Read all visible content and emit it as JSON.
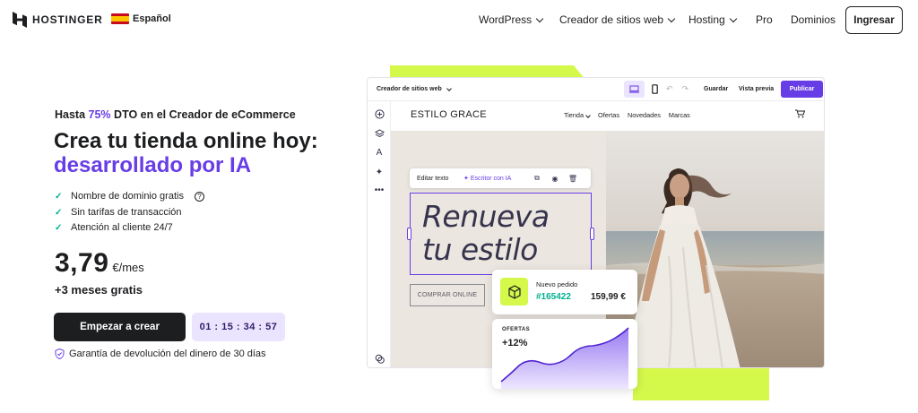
{
  "nav": {
    "brand": "HOSTINGER",
    "language": "Español",
    "menu": [
      {
        "label": "WordPress",
        "dropdown": true
      },
      {
        "label": "Creador de sitios web",
        "dropdown": true
      },
      {
        "label": "Hosting",
        "dropdown": true
      },
      {
        "label": "Pro",
        "dropdown": false
      },
      {
        "label": "Dominios",
        "dropdown": false
      }
    ],
    "login": "Ingresar"
  },
  "hero": {
    "kicker_prefix": "Hasta ",
    "kicker_highlight": "75%",
    "kicker_suffix": " DTO en el Creador de eCommerce",
    "title_line1": "Crea tu tienda online hoy:",
    "title_line2": "desarrollado por IA",
    "features": [
      "Nombre de dominio gratis",
      "Sin tarifas de transacción",
      "Atención al cliente 24/7"
    ],
    "price": "3,79",
    "price_unit": "€/mes",
    "bonus": "+3 meses gratis",
    "cta": "Empezar a crear",
    "timer": "01 : 15 : 34 : 57",
    "guarantee": "Garantía de devolución del dinero de 30 días"
  },
  "editor": {
    "selector": "Creador de sitios web",
    "save": "Guardar",
    "preview": "Vista previa",
    "publish": "Publicar",
    "site": {
      "brand": "ESTILO GRACE",
      "menu": [
        "Tienda",
        "Ofertas",
        "Novedades",
        "Marcas"
      ],
      "headline_line1": "Renueva",
      "headline_line2": "tu estilo",
      "shop_button": "COMPRAR ONLINE"
    },
    "toolbar": {
      "edit": "Editar texto",
      "ai": "Escritor con IA"
    }
  },
  "order_card": {
    "label": "Nuevo pedido",
    "number": "#165422",
    "amount": "159,99 €"
  },
  "offers_card": {
    "label": "OFERTAS",
    "change": "+12%"
  },
  "colors": {
    "accent": "#673de6",
    "lime": "#d4f94b",
    "dark": "#1d1e20",
    "green": "#00b090"
  }
}
